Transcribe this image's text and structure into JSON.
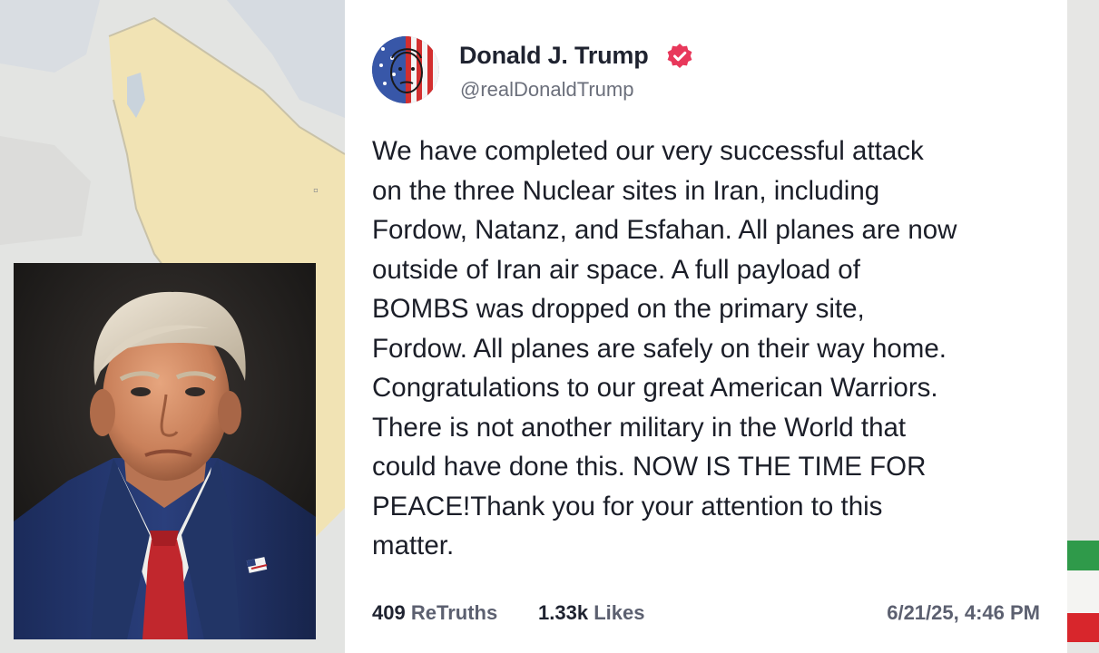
{
  "post": {
    "display_name": "Donald J. Trump",
    "handle": "@realDonaldTrump",
    "verified": true,
    "text": "We have completed our very successful attack\non the three Nuclear sites in Iran, including\nFordow, Natanz, and Esfahan. All planes are now\noutside of Iran air space. A full payload of\nBOMBS was dropped on the primary site,\nFordow. All planes are safely on their way home.\nCongratulations to our great American Warriors.\nThere is not another military in the World that\ncould have done this. NOW IS THE TIME FOR\nPEACE!Thank you for your attention to this\nmatter.",
    "retruths_count": "409",
    "retruths_label": "ReTruths",
    "likes_count": "1.33k",
    "likes_label": "Likes",
    "timestamp": "6/21/25, 4:46 PM"
  },
  "colors": {
    "verified_badge": "#e8385b",
    "name_text": "#1f2330",
    "muted_text": "#6b6f7b"
  },
  "icons": {
    "verified": "verified-badge-icon",
    "avatar": "flag-face-avatar"
  }
}
